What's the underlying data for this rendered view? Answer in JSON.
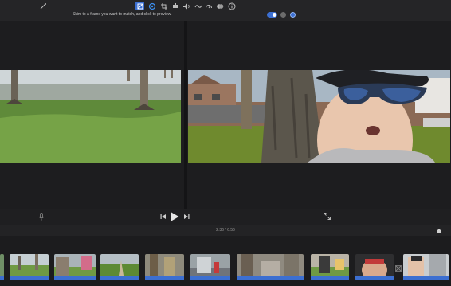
{
  "toolbar": {
    "hint": "Skim to a frame you want to match, and click to preview.",
    "tools": [
      "magic-wand-icon",
      "color-balance-icon",
      "color-correction-icon",
      "crop-icon",
      "stabilization-icon",
      "volume-icon",
      "noise-reduction-icon",
      "speed-icon",
      "filter-icon",
      "info-icon"
    ]
  },
  "timecode": "2:36 / 6:56",
  "clips": [
    "clip-1",
    "clip-2",
    "clip-3",
    "clip-4",
    "clip-5",
    "clip-6",
    "clip-7",
    "clip-8",
    "clip-9",
    "clip-10"
  ]
}
